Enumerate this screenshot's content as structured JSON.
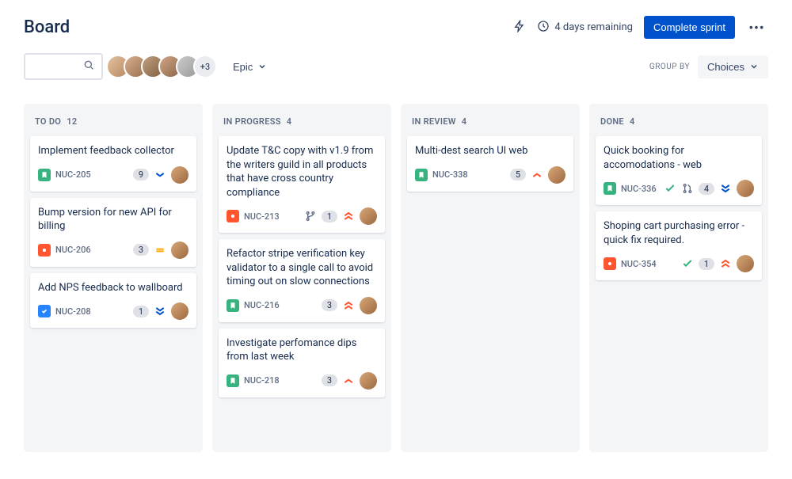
{
  "header": {
    "title": "Board",
    "remaining": "4 days remaining",
    "complete_sprint": "Complete sprint"
  },
  "toolbar": {
    "epic": "Epic",
    "avatars_more": "+3",
    "group_by": "GROUP BY",
    "choices": "Choices"
  },
  "columns": [
    {
      "title": "TO DO",
      "count": "12"
    },
    {
      "title": "IN PROGRESS",
      "count": "4"
    },
    {
      "title": "IN REVIEW",
      "count": "4"
    },
    {
      "title": "DONE",
      "count": "4"
    }
  ],
  "cards": {
    "c0": {
      "title": "Implement feedback collector",
      "ticket": "NUC-205",
      "points": "9"
    },
    "c1": {
      "title": "Bump version for new API for billing",
      "ticket": "NUC-206",
      "points": "3"
    },
    "c2": {
      "title": "Add NPS feedback to wallboard",
      "ticket": "NUC-208",
      "points": "1"
    },
    "c3": {
      "title": "Update T&C copy with v1.9 from the writers guild in all products that have cross country compliance",
      "ticket": "NUC-213",
      "points": "1"
    },
    "c4": {
      "title": "Refactor stripe verification key validator to a single call to avoid timing out on slow connections",
      "ticket": "NUC-216",
      "points": "3"
    },
    "c5": {
      "title": "Investigate perfomance dips from last week",
      "ticket": "NUC-218",
      "points": "3"
    },
    "c6": {
      "title": "Multi-dest search UI web",
      "ticket": "NUC-338",
      "points": "5"
    },
    "c7": {
      "title": "Quick booking for accomodations - web",
      "ticket": "NUC-336",
      "points": "4"
    },
    "c8": {
      "title": "Shoping cart purchasing error - quick fix required.",
      "ticket": "NUC-354",
      "points": "1"
    }
  }
}
